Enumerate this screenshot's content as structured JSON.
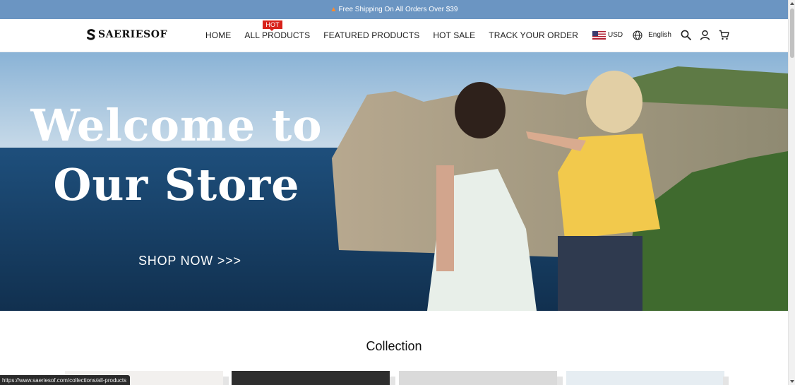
{
  "announcement": {
    "icon": "fire-icon",
    "text": "Free Shipping On All Orders Over $39"
  },
  "header": {
    "logo_text": "SAERIESOF",
    "nav": [
      {
        "label": "HOME"
      },
      {
        "label": "ALL PRODUCTS",
        "badge": "HOT"
      },
      {
        "label": "FEATURED PRODUCTS"
      },
      {
        "label": "HOT SALE"
      },
      {
        "label": "TRACK YOUR ORDER"
      }
    ],
    "currency": "USD",
    "language": "English",
    "icons": [
      "us-flag-icon",
      "globe-icon",
      "search-icon",
      "account-icon",
      "cart-icon"
    ]
  },
  "hero": {
    "title_line1": "Welcome to",
    "title_line2": "Our Store",
    "cta": "SHOP NOW >>>"
  },
  "collection": {
    "title": "Collection"
  },
  "status_bar": {
    "url": "https://www.saeriesof.com/collections/all-products"
  },
  "colors": {
    "announcement_bg": "#6b95c2",
    "hot_badge": "#d8231b"
  }
}
